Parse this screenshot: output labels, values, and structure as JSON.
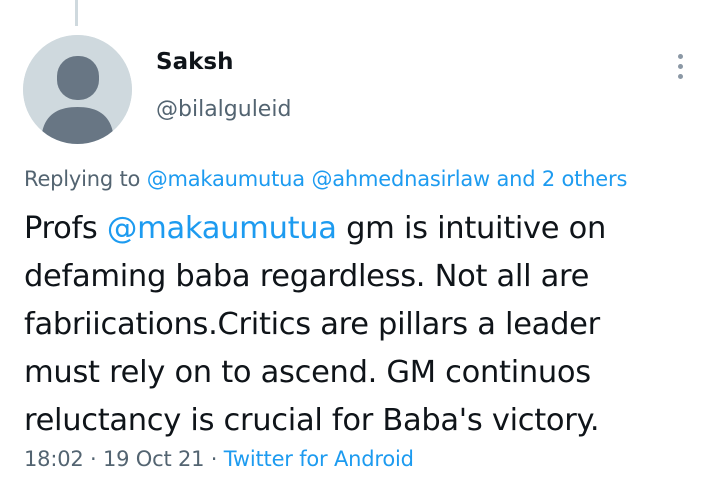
{
  "author": {
    "display_name": "Saksh",
    "handle": "@bilalguleid"
  },
  "reply_context": {
    "prefix": "Replying to",
    "mentions": [
      "@makaumutua",
      "@ahmednasirlaw"
    ],
    "others_link": "and 2 others"
  },
  "tweet": {
    "lines": [
      {
        "pre": "Profs ",
        "mention": "@makaumutua",
        "post": " gm is intuitive on"
      },
      "defaming baba regardless. Not all are",
      "fabriications.Critics are pillars a leader",
      "must rely on to ascend. GM continuos",
      "reluctancy is crucial for Baba's victory."
    ]
  },
  "meta": {
    "time": "18:02",
    "separator": "·",
    "date": "19 Oct 21",
    "source": "Twitter for Android"
  },
  "icons": {
    "avatar": "default-avatar-icon",
    "more": "more-options-icon"
  },
  "colors": {
    "link": "#1d9bf0",
    "secondary_text": "#536471",
    "primary_text": "#0f1419",
    "avatar_bg": "#cfd9de",
    "avatar_figure": "#687684"
  }
}
